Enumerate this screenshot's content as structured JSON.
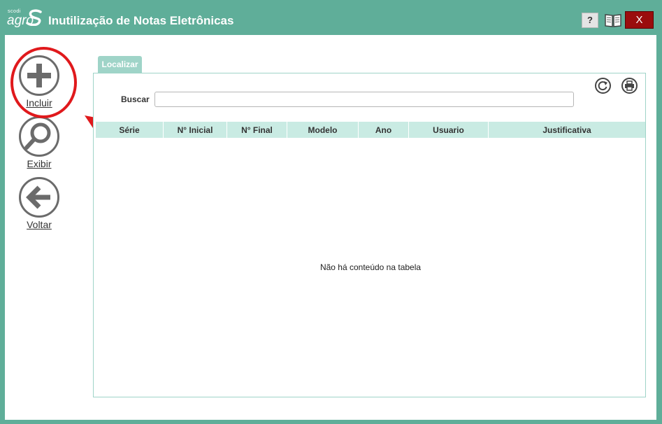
{
  "app": {
    "logo_small": "scodi",
    "logo_big": "agro",
    "title": "Inutilização de Notas Eletrônicas"
  },
  "titlebar": {
    "help_label": "?",
    "close_label": "X"
  },
  "sidebar": {
    "items": [
      {
        "label": "Incluir",
        "icon": "plus-icon"
      },
      {
        "label": "Exibir",
        "icon": "magnifier-icon"
      },
      {
        "label": "Voltar",
        "icon": "back-arrow-icon"
      }
    ]
  },
  "tabs": [
    {
      "label": "Localizar",
      "active": true
    }
  ],
  "search": {
    "label": "Buscar",
    "value": ""
  },
  "toolbar": {
    "refresh_icon": "refresh-icon",
    "print_icon": "print-icon"
  },
  "table": {
    "columns": [
      "Série",
      "N° Inicial",
      "N° Final",
      "Modelo",
      "Ano",
      "Usuario",
      "Justificativa"
    ],
    "rows": [],
    "empty_message": "Não há conteúdo na tabela"
  },
  "colors": {
    "frame": "#5fae99",
    "tab": "#9fd4c8",
    "table_header": "#c9ebe3",
    "close_button": "#9a0d0d",
    "highlight": "#e0191c"
  }
}
